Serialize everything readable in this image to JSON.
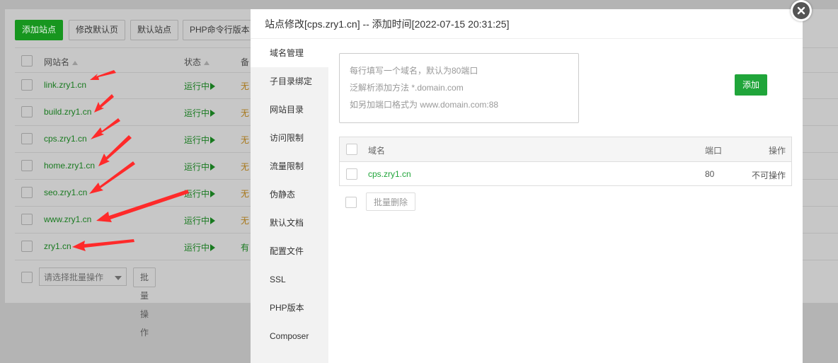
{
  "toolbar": {
    "buttons": [
      "添加站点",
      "修改默认页",
      "默认站点",
      "PHP命令行版本"
    ]
  },
  "site_table": {
    "headers": {
      "name": "网站名",
      "status": "状态",
      "note": "备"
    },
    "rows": [
      {
        "name": "link.zry1.cn",
        "status": "运行中",
        "note": "无"
      },
      {
        "name": "build.zry1.cn",
        "status": "运行中",
        "note": "无"
      },
      {
        "name": "cps.zry1.cn",
        "status": "运行中",
        "note": "无"
      },
      {
        "name": "home.zry1.cn",
        "status": "运行中",
        "note": "无"
      },
      {
        "name": "seo.zry1.cn",
        "status": "运行中",
        "note": "无"
      },
      {
        "name": "www.zry1.cn",
        "status": "运行中",
        "note": "无"
      },
      {
        "name": "zry1.cn",
        "status": "运行中",
        "note": "有"
      }
    ]
  },
  "bulk": {
    "select_placeholder": "请选择批量操作",
    "button": "批量操作"
  },
  "dialog": {
    "title": "站点修改[cps.zry1.cn] -- 添加时间[2022-07-15 20:31:25]",
    "nav": [
      "域名管理",
      "子目录绑定",
      "网站目录",
      "访问限制",
      "流量限制",
      "伪静态",
      "默认文档",
      "配置文件",
      "SSL",
      "PHP版本",
      "Composer"
    ],
    "active_nav": "域名管理",
    "domain_input_placeholder": [
      "每行填写一个域名，默认为80端口",
      "泛解析添加方法 *.domain.com",
      "如另加端口格式为 www.domain.com:88"
    ],
    "add_button": "添加",
    "table": {
      "headers": {
        "domain": "域名",
        "port": "端口",
        "op": "操作"
      },
      "rows": [
        {
          "domain": "cps.zry1.cn",
          "port": "80",
          "op": "不可操作"
        }
      ]
    },
    "batch_delete": "批量删除"
  },
  "colors": {
    "primary": "#20a53a",
    "arrow": "#ff2a2a",
    "overlay": "#b4b4b4"
  }
}
